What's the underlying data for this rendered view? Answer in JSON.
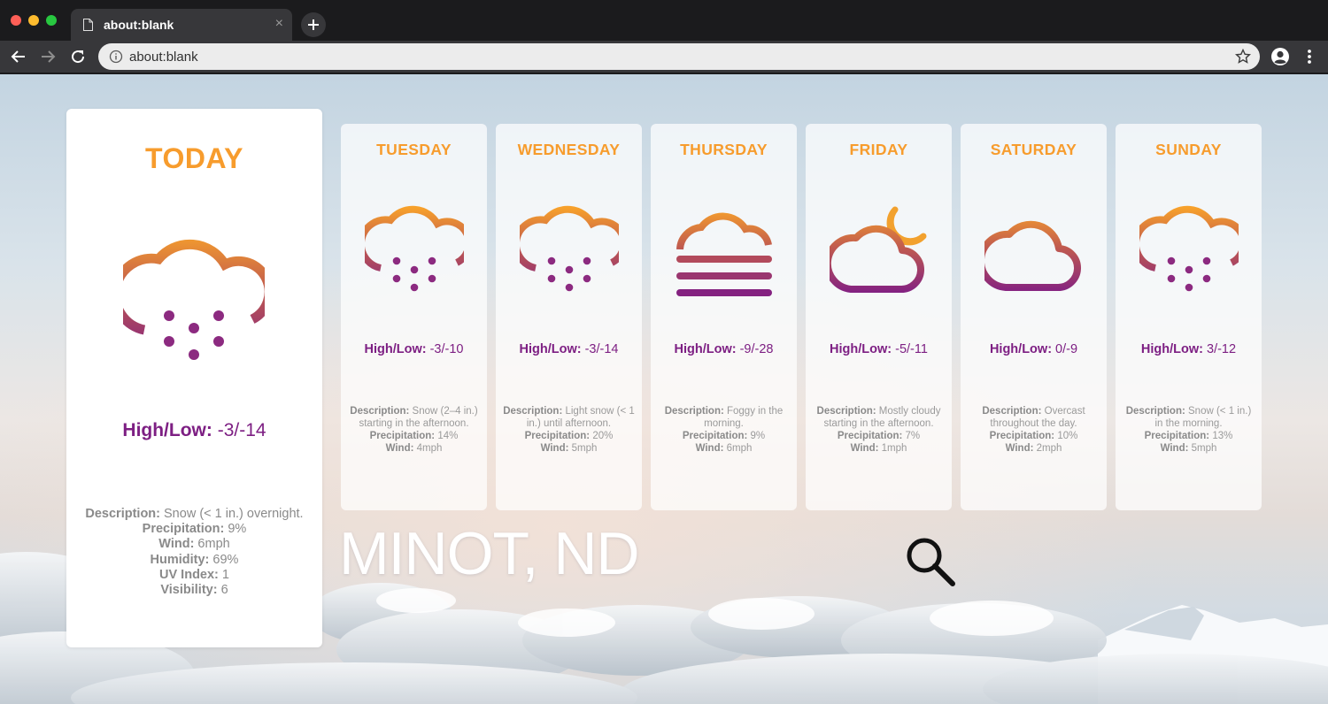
{
  "browser": {
    "tab_title": "about:blank",
    "tab_close": "×",
    "url": "about:blank",
    "icons": [
      "file-icon",
      "close-icon",
      "plus-icon",
      "back-arrow-icon",
      "forward-arrow-icon",
      "reload-icon",
      "info-icon",
      "star-icon",
      "profile-icon",
      "menu-dots-icon"
    ]
  },
  "today": {
    "title": "TODAY",
    "icon": "snow-icon",
    "hilo_label": "High/Low:",
    "hilo_value": " -3/-14",
    "description_label": "Description:",
    "description_value": " Snow (< 1 in.) overnight.",
    "precip_label": "Precipitation:",
    "precip_value": " 9%",
    "wind_label": "Wind:",
    "wind_value": " 6mph",
    "humidity_label": "Humidity:",
    "humidity_value": " 69%",
    "uv_label": "UV Index:",
    "uv_value": " 1",
    "visibility_label": "Visibility:",
    "visibility_value": " 6"
  },
  "days": [
    {
      "title": "TUESDAY",
      "icon": "snow-icon",
      "hilo_label": "High/Low:",
      "hilo_value": " -3/-10",
      "description_label": "Description:",
      "description_value": " Snow (2–4 in.) starting in the afternoon.",
      "precip_label": "Precipitation:",
      "precip_value": " 14%",
      "wind_label": "Wind:",
      "wind_value": " 4mph"
    },
    {
      "title": "WEDNESDAY",
      "icon": "snow-icon",
      "hilo_label": "High/Low:",
      "hilo_value": " -3/-14",
      "description_label": "Description:",
      "description_value": " Light snow (< 1 in.) until afternoon.",
      "precip_label": "Precipitation:",
      "precip_value": " 20%",
      "wind_label": "Wind:",
      "wind_value": " 5mph"
    },
    {
      "title": "THURSDAY",
      "icon": "fog-icon",
      "hilo_label": "High/Low:",
      "hilo_value": " -9/-28",
      "description_label": "Description:",
      "description_value": " Foggy in the morning.",
      "precip_label": "Precipitation:",
      "precip_value": " 9%",
      "wind_label": "Wind:",
      "wind_value": " 6mph"
    },
    {
      "title": "FRIDAY",
      "icon": "partly-cloudy-night-icon",
      "hilo_label": "High/Low:",
      "hilo_value": " -5/-11",
      "description_label": "Description:",
      "description_value": " Mostly cloudy starting in the afternoon.",
      "precip_label": "Precipitation:",
      "precip_value": " 7%",
      "wind_label": "Wind:",
      "wind_value": " 1mph"
    },
    {
      "title": "SATURDAY",
      "icon": "cloudy-icon",
      "hilo_label": "High/Low:",
      "hilo_value": " 0/-9",
      "description_label": "Description:",
      "description_value": " Overcast throughout the day.",
      "precip_label": "Precipitation:",
      "precip_value": " 10%",
      "wind_label": "Wind:",
      "wind_value": " 2mph"
    },
    {
      "title": "SUNDAY",
      "icon": "snow-icon",
      "hilo_label": "High/Low:",
      "hilo_value": " 3/-12",
      "description_label": "Description:",
      "description_value": " Snow (< 1 in.) in the morning.",
      "precip_label": "Precipitation:",
      "precip_value": " 13%",
      "wind_label": "Wind:",
      "wind_value": " 5mph"
    }
  ],
  "location": {
    "city": "MINOT, ND"
  },
  "search": {
    "icon": "search-icon"
  },
  "colors": {
    "accent_orange": "#f79c2d",
    "accent_purple": "#7d1f83",
    "detail_gray": "#8a8a8a"
  }
}
